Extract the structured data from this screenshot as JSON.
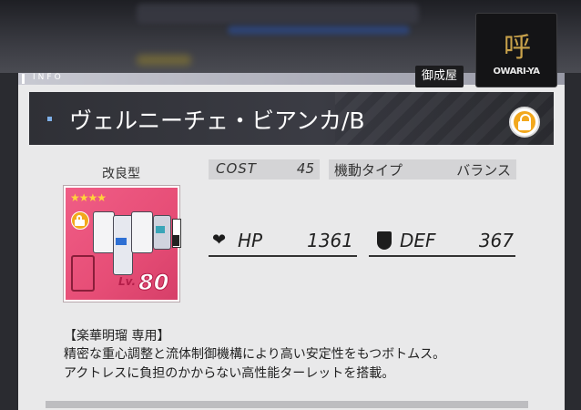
{
  "header": {
    "info_label": "INFO",
    "maker_tag": "御成屋",
    "logo_mark": "呼",
    "logo_text": "OWARI-YA"
  },
  "unit": {
    "name": "ヴェルニーチェ・ビアンカ/B",
    "type": "改良型",
    "rarity_stars": "★★★★",
    "level_label": "Lv.",
    "level": "80",
    "locked": true
  },
  "stats": {
    "cost_label": "COST",
    "cost": "45",
    "mobility_label": "機動タイプ",
    "mobility": "バランス",
    "hp_label": "HP",
    "hp": "1361",
    "def_label": "DEF",
    "def": "367"
  },
  "description": {
    "exclusive": "【楽華明瑠 専用】",
    "line1": "精密な重心調整と流体制御機構により高い安定性をもつボトムス。",
    "line2": "アクトレスに負担のかからない高性能ターレットを搭載。"
  },
  "colors": {
    "card_bg": "#e64d76",
    "lock_accent": "#f2a81d",
    "name_bar": "#34353b",
    "panel": "#e9e9ea"
  },
  "icons": [
    "lock-icon",
    "heart-icon",
    "shield-icon",
    "star-icon"
  ]
}
